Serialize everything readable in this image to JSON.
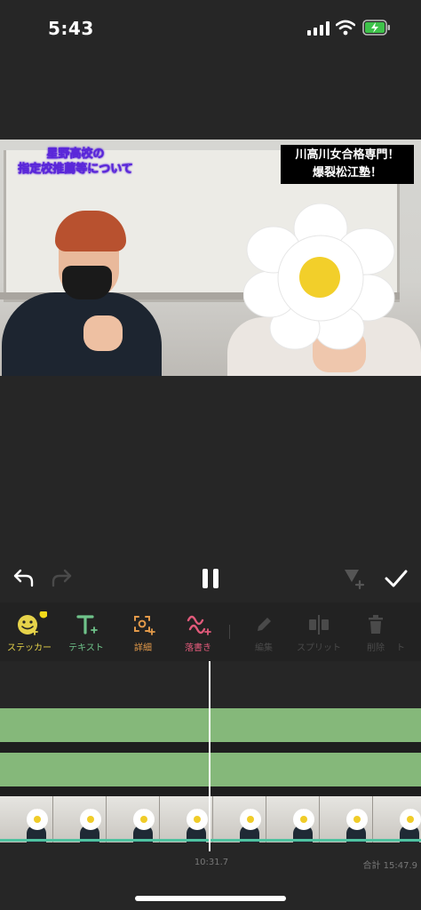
{
  "status_bar": {
    "time": "5:43"
  },
  "video": {
    "caption_left_line1": "星野高校の",
    "caption_left_line2": "指定校推薦等について",
    "caption_right_line1": "川高川女合格専門！",
    "caption_right_line2": "爆裂松江塾！"
  },
  "toolbar": {
    "items": [
      {
        "label": "ステッカー",
        "icon": "sticker-icon",
        "color": "#e6d34a"
      },
      {
        "label": "テキスト",
        "icon": "text-icon",
        "color": "#6fc38a"
      },
      {
        "label": "詳細",
        "icon": "detail-icon",
        "color": "#e39a4a"
      },
      {
        "label": "落書き",
        "icon": "scribble-icon",
        "color": "#e05a7a"
      },
      {
        "label": "編集",
        "icon": "pencil-icon",
        "color": "#4a4a4a"
      },
      {
        "label": "スプリット",
        "icon": "split-icon",
        "color": "#4a4a4a"
      },
      {
        "label": "削除",
        "icon": "trash-icon",
        "color": "#4a4a4a"
      },
      {
        "label": "ト",
        "icon": "",
        "color": "#4a4a4a"
      }
    ]
  },
  "timeline": {
    "current_time": "10:31.7",
    "total_time": "合計 15:47.9",
    "track_color": "#85b87a",
    "audio_color": "#4fc2a0"
  }
}
